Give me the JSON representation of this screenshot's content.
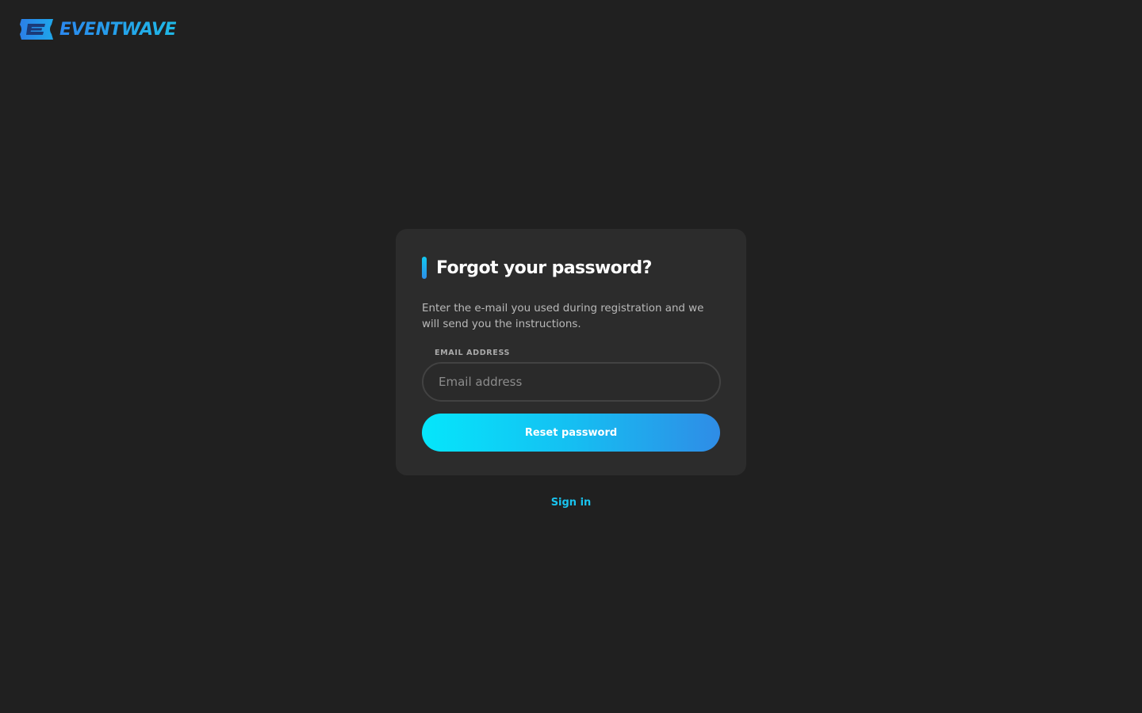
{
  "brand": {
    "name": "EVENTWAVE",
    "logo_icon": "ticket-e-icon",
    "colors": {
      "primary": "#2b88ee",
      "secondary": "#1fb9e6"
    }
  },
  "card": {
    "title": "Forgot your password?",
    "description": "Enter the e-mail you used during registration and we will send you the instructions.",
    "email": {
      "label": "EMAIL ADDRESS",
      "placeholder": "Email address",
      "value": ""
    },
    "submit_label": "Reset password"
  },
  "footer": {
    "signin_label": "Sign in"
  },
  "theme": {
    "background": "#202020",
    "card": "#2c2c2c",
    "accent_start": "#05e6fb",
    "accent_end": "#2f8ce6",
    "link": "#19c3ee"
  }
}
